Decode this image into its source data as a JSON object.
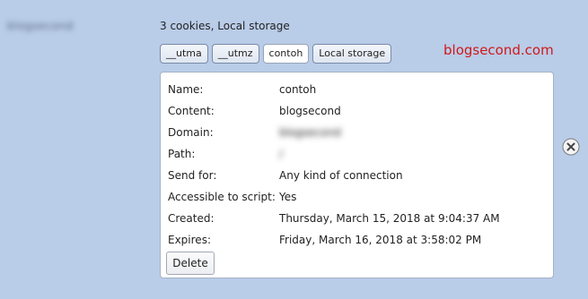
{
  "site": {
    "name": "blogsecond"
  },
  "summary": "3 cookies, Local storage",
  "chips": [
    {
      "label": "__utma"
    },
    {
      "label": "__utmz"
    },
    {
      "label": "contoh"
    },
    {
      "label": "Local storage"
    }
  ],
  "watermark": "blogsecond.com",
  "details": {
    "fields": [
      {
        "label": "Name:",
        "value": "contoh"
      },
      {
        "label": "Content:",
        "value": "blogsecond"
      },
      {
        "label": "Domain:",
        "value": "blogsecond"
      },
      {
        "label": "Path:",
        "value": "/"
      },
      {
        "label": "Send for:",
        "value": "Any kind of connection"
      },
      {
        "label": "Accessible to script:",
        "value": "Yes"
      },
      {
        "label": "Created:",
        "value": "Thursday, March 15, 2018 at 9:04:37 AM"
      },
      {
        "label": "Expires:",
        "value": "Friday, March 16, 2018 at 3:58:02 PM"
      }
    ],
    "delete_label": "Delete"
  },
  "icons": {
    "remove": "close-circle-icon"
  }
}
